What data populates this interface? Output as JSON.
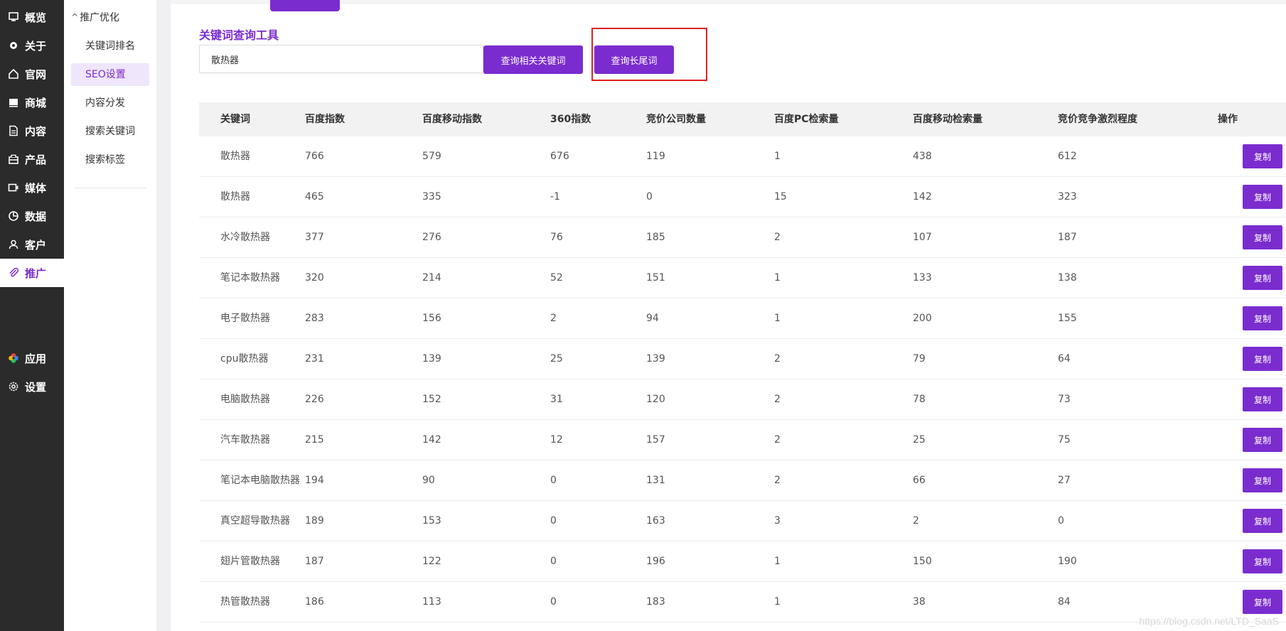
{
  "left_nav": [
    {
      "label": "概览",
      "icon": "dashboard-icon"
    },
    {
      "label": "关于",
      "icon": "gear-icon"
    },
    {
      "label": "官网",
      "icon": "home-icon"
    },
    {
      "label": "商城",
      "icon": "shop-icon"
    },
    {
      "label": "内容",
      "icon": "document-icon"
    },
    {
      "label": "产品",
      "icon": "product-icon"
    },
    {
      "label": "媒体",
      "icon": "video-icon"
    },
    {
      "label": "数据",
      "icon": "chart-pie-icon"
    },
    {
      "label": "客户",
      "icon": "user-icon"
    },
    {
      "label": "推广",
      "icon": "paperclip-icon",
      "active": true
    }
  ],
  "bottom_nav": [
    {
      "label": "应用",
      "icon": "apps-icon"
    },
    {
      "label": "设置",
      "icon": "settings-icon"
    }
  ],
  "sub_nav": {
    "group_label": "推广优化",
    "items": [
      {
        "label": "关键词排名"
      },
      {
        "label": "SEO设置",
        "active": true
      },
      {
        "label": "内容分发"
      },
      {
        "label": "搜索关键词"
      },
      {
        "label": "搜索标签"
      }
    ]
  },
  "tool": {
    "title": "关键词查询工具",
    "input_value": "散热器",
    "btn_related": "查询相关关键词",
    "btn_longtail": "查询长尾词"
  },
  "table": {
    "headers": [
      "关键词",
      "百度指数",
      "百度移动指数",
      "360指数",
      "竞价公司数量",
      "百度PC检索量",
      "百度移动检索量",
      "竞价竞争激烈程度",
      "操作"
    ],
    "action_label": "复制",
    "rows": [
      [
        "散热器",
        "766",
        "579",
        "676",
        "119",
        "1",
        "438",
        "612"
      ],
      [
        "散热器",
        "465",
        "335",
        "-1",
        "0",
        "15",
        "142",
        "323"
      ],
      [
        "水冷散热器",
        "377",
        "276",
        "76",
        "185",
        "2",
        "107",
        "187"
      ],
      [
        "笔记本散热器",
        "320",
        "214",
        "52",
        "151",
        "1",
        "133",
        "138"
      ],
      [
        "电子散热器",
        "283",
        "156",
        "2",
        "94",
        "1",
        "200",
        "155"
      ],
      [
        "cpu散热器",
        "231",
        "139",
        "25",
        "139",
        "2",
        "79",
        "64"
      ],
      [
        "电脑散热器",
        "226",
        "152",
        "31",
        "120",
        "2",
        "78",
        "73"
      ],
      [
        "汽车散热器",
        "215",
        "142",
        "12",
        "157",
        "2",
        "25",
        "75"
      ],
      [
        "笔记本电脑散热器",
        "194",
        "90",
        "0",
        "131",
        "2",
        "66",
        "27"
      ],
      [
        "真空超导散热器",
        "189",
        "153",
        "0",
        "163",
        "3",
        "2",
        "0"
      ],
      [
        "翅片管散热器",
        "187",
        "122",
        "0",
        "196",
        "1",
        "150",
        "190"
      ],
      [
        "热管散热器",
        "186",
        "113",
        "0",
        "183",
        "1",
        "38",
        "84"
      ]
    ]
  },
  "watermark": "https://blog.csdn.net/LTD_SaaS",
  "colors": {
    "accent": "#7b2ccf",
    "nav_bg": "#2b2b2b",
    "highlight": "#e02020"
  }
}
